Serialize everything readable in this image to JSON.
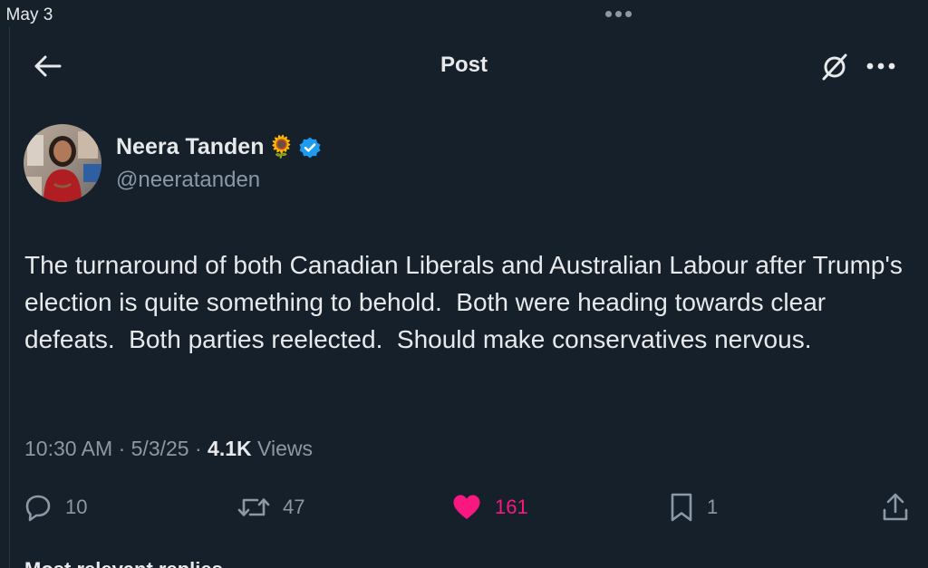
{
  "status_bar": {
    "date": ": May 3"
  },
  "header": {
    "title": "Post",
    "back_icon": "arrow-left-icon",
    "grok_icon": "grok-icon",
    "more_icon": "more-horizontal-icon"
  },
  "author": {
    "name": "Neera Tanden",
    "emoji": "🌻",
    "handle": "@neeratanden",
    "verified": true,
    "verified_color": "#1d9bf0"
  },
  "post": {
    "text": "The turnaround of both Canadian Liberals and Australian Labour after Trump's election is quite something to behold.  Both were heading towards clear defeats.  Both parties reelected.  Should make conservatives nervous.",
    "time": "10:30 AM",
    "separator": " · ",
    "date": "5/3/25",
    "views_count": "4.1K",
    "views_label": " Views"
  },
  "actions": {
    "replies": "10",
    "reposts": "47",
    "likes": "161",
    "bookmarks": "1",
    "like_color": "#f91880"
  },
  "footer_peek": {
    "text": "Most relevant replies"
  },
  "colors": {
    "background": "#15202b",
    "text": "#e7e9ea",
    "muted": "#8b98a5"
  }
}
